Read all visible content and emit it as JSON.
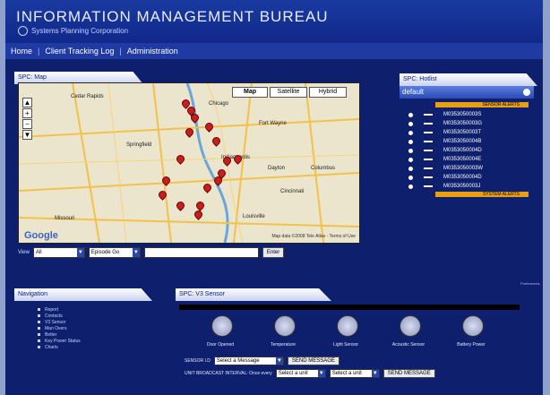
{
  "header": {
    "title": "INFORMATION MANAGEMENT BUREAU",
    "subtitle": "Systems Planning Corporation"
  },
  "nav": {
    "items": [
      "Home",
      "Client Tracking Log",
      "Administration"
    ]
  },
  "map_panel": {
    "title": "SPC: Map",
    "types": [
      "Map",
      "Satellite",
      "Hybrid"
    ],
    "cities": [
      "Cedar Rapids",
      "Chicago",
      "Fort Wayne",
      "Dayton",
      "Columbus",
      "Springfield",
      "Indianapolis",
      "Cincinnati",
      "Louisville",
      "Missouri"
    ],
    "google": "Google",
    "map_data": "Map data ©2008 Tele Atlas - Terms of Use"
  },
  "filter": {
    "label": "View",
    "select1": "All",
    "select2": "Episode Go",
    "button": "Enter"
  },
  "hotlist": {
    "title": "SPC: Hotlist",
    "group": "default",
    "sensor_alerts": "SENSOR ALERTS",
    "system_alerts": "SYSTEM ALERTS",
    "items": [
      "M0353050003S",
      "M0353050003G",
      "M0353050003T",
      "M0353050004B",
      "M0353050004D",
      "M0353050004E",
      "M0353050003W",
      "M0353050004D",
      "M0353050003J"
    ]
  },
  "navigation": {
    "title": "Navigation",
    "items": [
      "Report",
      "Contacts",
      "V3 Sensor",
      "Man Overs",
      "Better",
      "Key Power Status",
      "Charts"
    ]
  },
  "sensor": {
    "title": "SPC: V3 Sensor",
    "icons": [
      {
        "label": "Door Opened",
        "icon": "door-icon"
      },
      {
        "label": "Temperature",
        "icon": "thermometer-icon"
      },
      {
        "label": "Light Sensor",
        "icon": "light-sensor-icon"
      },
      {
        "label": "Acoustic Sensor",
        "icon": "acoustic-icon"
      },
      {
        "label": "Battery Power",
        "icon": "battery-icon"
      }
    ],
    "sensor_id_label": "SENSOR I.D",
    "sensor_id_select": "Select a Message",
    "send_message": "SEND MESSAGE",
    "interval_label": "UNIT BROADCAST INTERVAL: Once every",
    "interval_select1": "Select a unit",
    "interval_select2": "Select a unit"
  },
  "side_label": "Preferences"
}
